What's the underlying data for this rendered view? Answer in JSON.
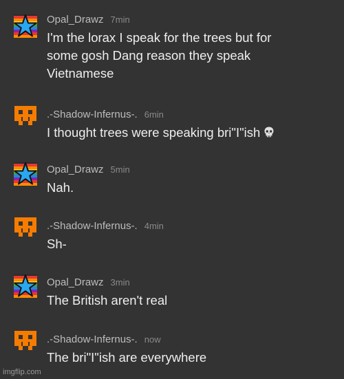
{
  "colors": {
    "background": "#333333",
    "username": "#bdbdbd",
    "timestamp": "#8a8a8a",
    "message_text": "#eeeeee",
    "shadow_avatar_orange": "#f57c00"
  },
  "messages": [
    {
      "username": "Opal_Drawz",
      "time": "7min",
      "avatar_icon": "rainbow-star-icon",
      "lines": [
        "I'm the lorax I speak for the trees but for",
        "some gosh Dang reason they speak",
        "Vietnamese"
      ]
    },
    {
      "username": ".-Shadow-Infernus-.",
      "time": "6min",
      "avatar_icon": "orange-skull-icon",
      "text": "I thought trees were speaking bri\"I\"ish",
      "emoji_icon": "skull-emoji-icon"
    },
    {
      "username": "Opal_Drawz",
      "time": "5min",
      "avatar_icon": "rainbow-star-icon",
      "text": "Nah."
    },
    {
      "username": ".-Shadow-Infernus-.",
      "time": "4min",
      "avatar_icon": "orange-skull-icon",
      "text": "Sh-"
    },
    {
      "username": "Opal_Drawz",
      "time": "3min",
      "avatar_icon": "rainbow-star-icon",
      "text": "The British aren't real"
    },
    {
      "username": ".-Shadow-Infernus-.",
      "time": "now",
      "avatar_icon": "orange-skull-icon",
      "text": "The bri\"I\"ish are everywhere"
    }
  ],
  "watermark": "imgflip.com"
}
